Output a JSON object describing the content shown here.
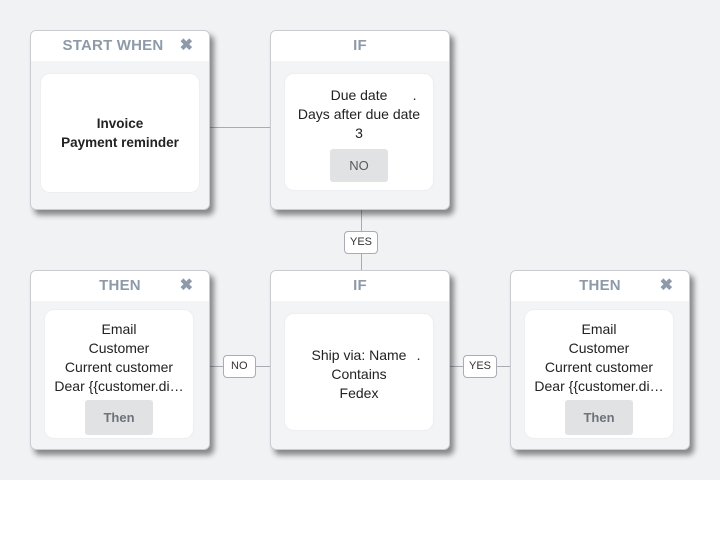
{
  "nodes": {
    "start": {
      "title": "START WHEN",
      "lines": [
        "Invoice",
        "Payment reminder"
      ]
    },
    "if1": {
      "title": "IF",
      "lines": [
        "Due date",
        "Days after due date",
        "3"
      ],
      "trailing_dot": ".",
      "button": "NO"
    },
    "then_left": {
      "title": "THEN",
      "lines": [
        "Email",
        "Customer",
        "Current customer",
        "Dear {{customer.di…"
      ],
      "button": "Then"
    },
    "if2": {
      "title": "IF",
      "lines": [
        "Ship via: Name",
        "Contains",
        "Fedex"
      ],
      "trailing_dot": "."
    },
    "then_right": {
      "title": "THEN",
      "lines": [
        "Email",
        "Customer",
        "Current customer",
        "Dear {{customer.di…"
      ],
      "button": "Then"
    }
  },
  "connectors": {
    "if1_to_if2": "YES",
    "if2_to_then_left": "NO",
    "if2_to_then_right": "YES"
  },
  "icons": {
    "close": "✖"
  }
}
